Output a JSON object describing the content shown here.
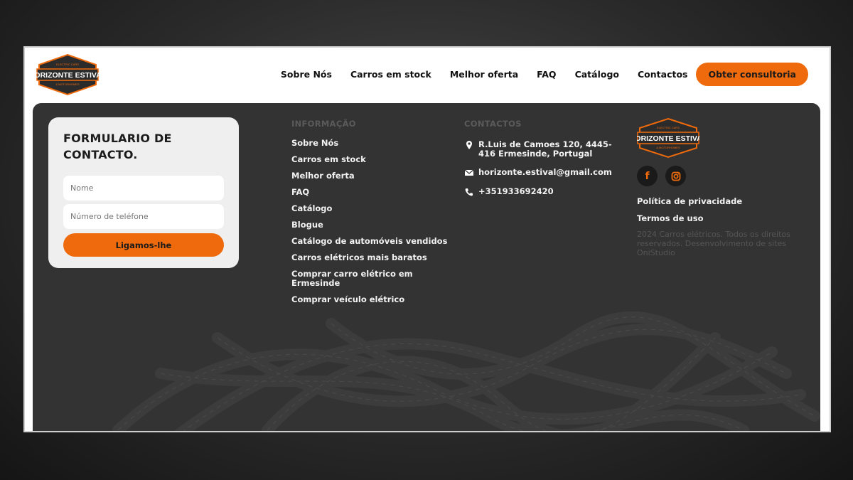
{
  "brand": {
    "name": "HORIZONTE ESTIVAL",
    "tagline_top": "ELECTRIC CARS",
    "tagline_bottom": "& MOTORHOMES"
  },
  "nav": {
    "items": [
      "Sobre Nós",
      "Carros em stock",
      "Melhor oferta",
      "FAQ",
      "Catálogo",
      "Contactos"
    ],
    "cta": "Obter consultoria"
  },
  "form": {
    "title_line1": "FORMULARIO DE",
    "title_line2": "CONTACTO.",
    "name_placeholder": "Nome",
    "phone_placeholder": "Número de teléfone",
    "submit": "Ligamos-lhe"
  },
  "info": {
    "title": "INFORMAÇÃO",
    "links": [
      "Sobre Nós",
      "Carros em stock",
      "Melhor oferta",
      "FAQ",
      "Catálogo",
      "Blogue",
      "Catálogo de automóveis vendidos",
      "Carros elétricos mais baratos",
      "Comprar carro elétrico em Ermesinde",
      "Comprar veículo elétrico"
    ]
  },
  "contacts": {
    "title": "CONTACTOS",
    "address": "R.Luis de Camoes 120, 4445-416 Ermesinde, Portugal",
    "email": "horizonte.estival@gmail.com",
    "phone": "+351933692420"
  },
  "legal": {
    "privacy": "Política de privacidade",
    "terms": "Termos de uso",
    "copyright": "2024 Carros elétricos. Todos os direitos reservados. Desenvolvimento de sites OniStudio"
  },
  "colors": {
    "accent": "#ee6a0c",
    "panel": "#333333",
    "logo_bg": "#2b2b2b"
  }
}
